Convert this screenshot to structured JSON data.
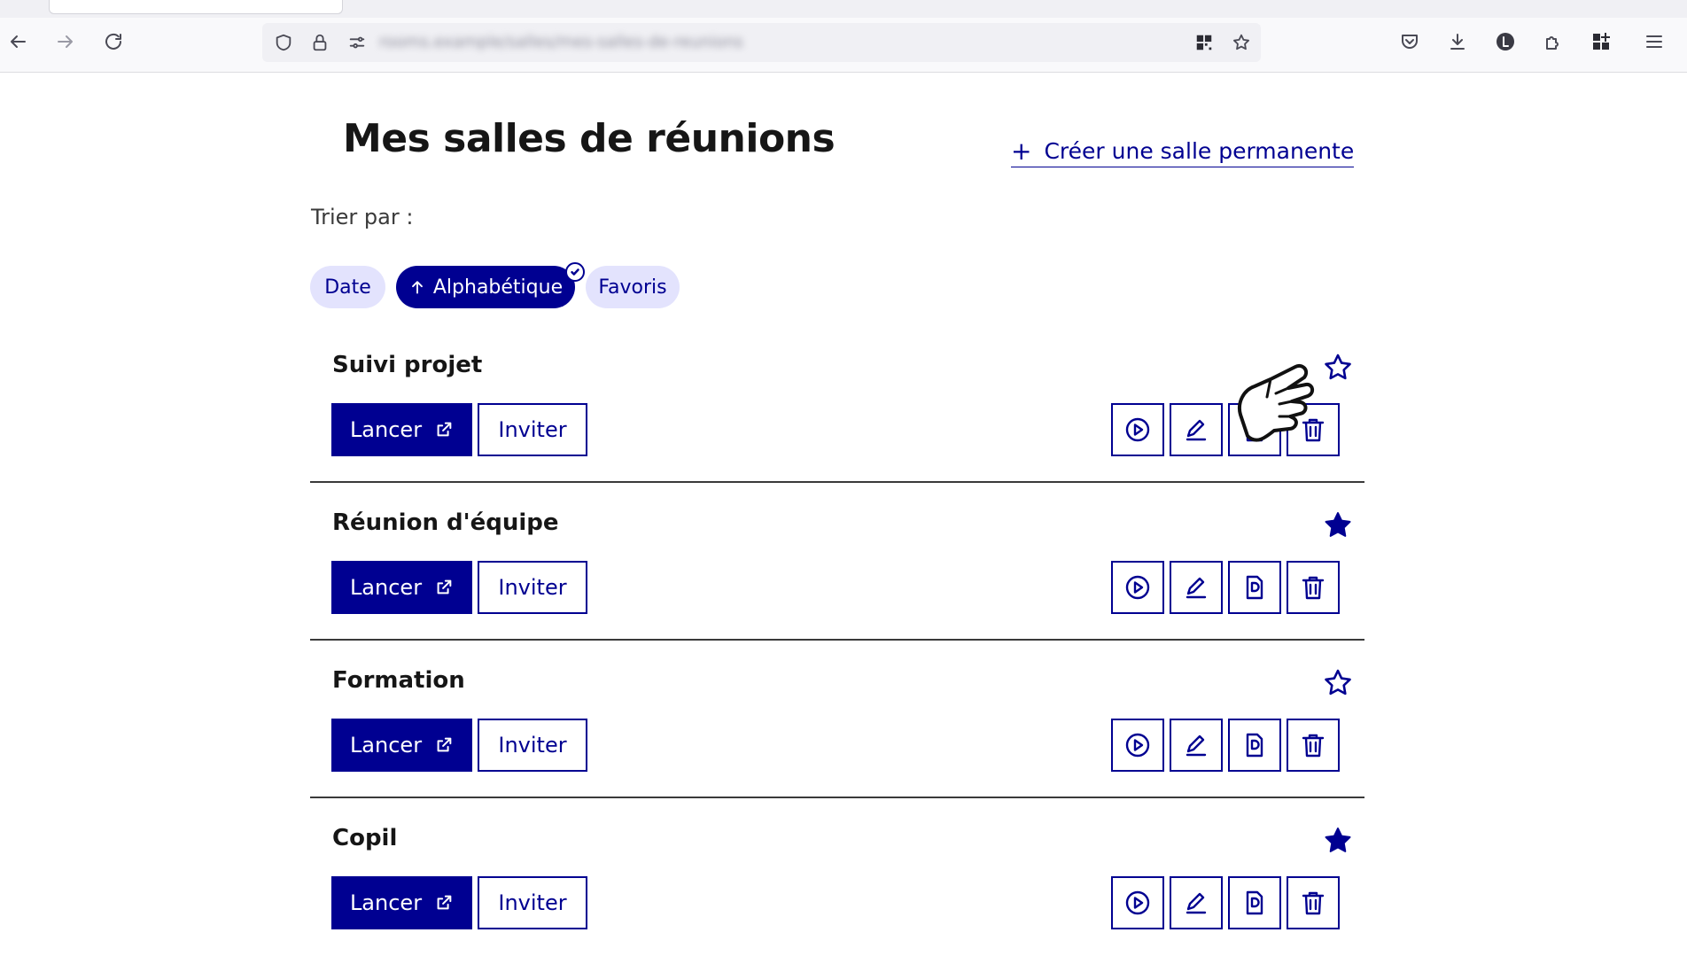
{
  "browser": {
    "url": "rooms.example/salles/mes-salles-de-reunions"
  },
  "page": {
    "title": "Mes salles de réunions",
    "create_link": "Créer une salle permanente",
    "create_plus": "+",
    "sort_label": "Trier par :",
    "sort_chips": [
      {
        "label": "Date",
        "selected": false
      },
      {
        "label": "Alphabétique",
        "selected": true,
        "direction_icon": "arrow-up-icon"
      },
      {
        "label": "Favoris",
        "selected": false
      }
    ]
  },
  "rooms": [
    {
      "name": "Suivi projet",
      "favorite": false,
      "launch_label": "Lancer",
      "invite_label": "Inviter"
    },
    {
      "name": "Réunion d'équipe",
      "favorite": true,
      "launch_label": "Lancer",
      "invite_label": "Inviter"
    },
    {
      "name": "Formation",
      "favorite": false,
      "launch_label": "Lancer",
      "invite_label": "Inviter"
    },
    {
      "name": "Copil",
      "favorite": true,
      "launch_label": "Lancer",
      "invite_label": "Inviter"
    }
  ],
  "room_actions": [
    "play-icon",
    "pencil-icon",
    "document-icon",
    "trash-icon"
  ],
  "colors": {
    "primary": "#000091",
    "chip_bg": "#e3e3fd",
    "text": "#161616",
    "separator": "#3a3a3a"
  }
}
